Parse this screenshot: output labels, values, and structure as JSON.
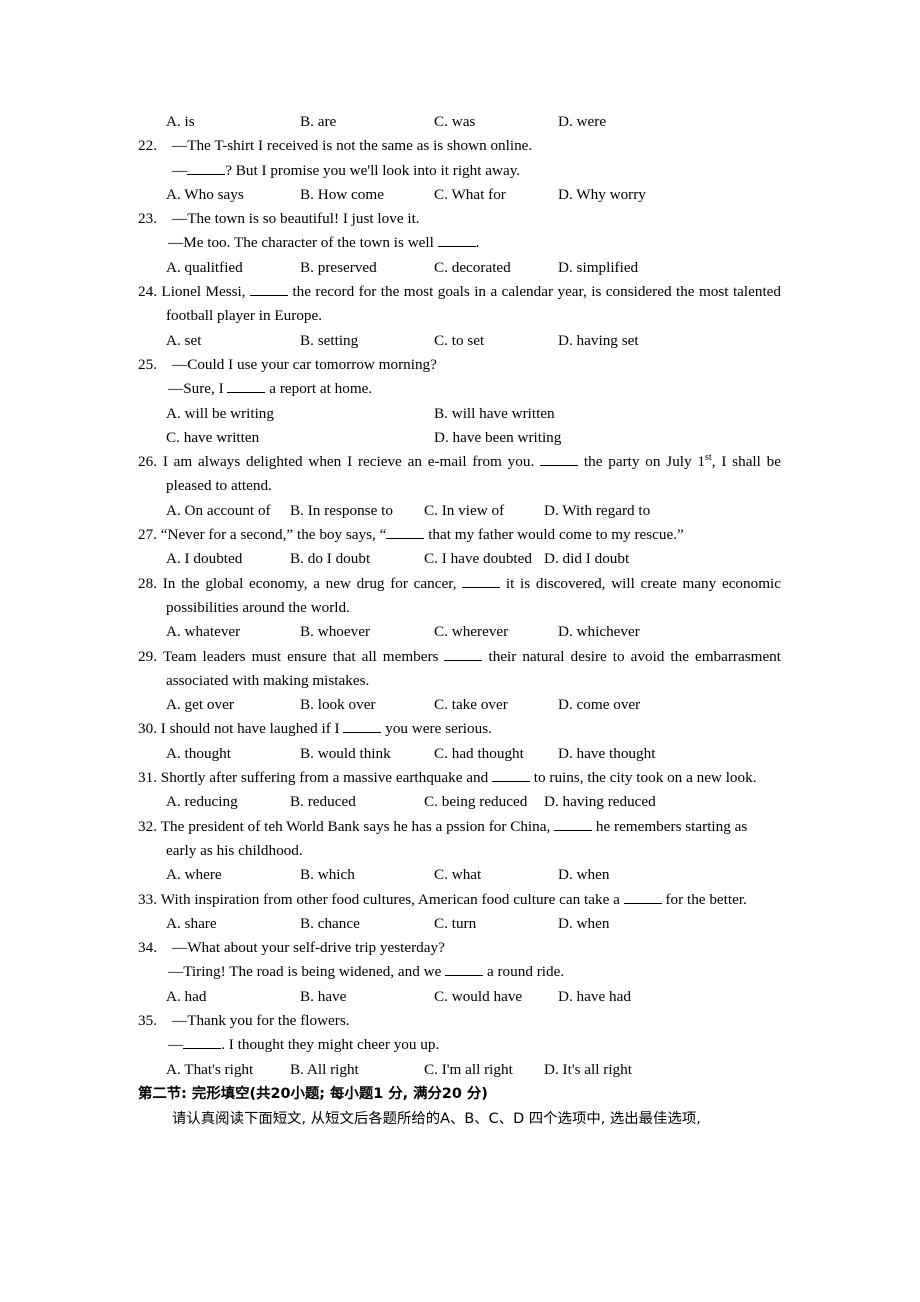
{
  "page": {
    "section_heading": "第二节: 完形填空(共20小题; 每小题1  分, 满分20  分)",
    "section_instruction": "请认真阅读下面短文, 从短文后各题所给的A、B、C、D  四个选项中, 选出最佳选项,"
  },
  "carryover_options": {
    "a": "A. is",
    "b": "B. are",
    "c": "C. was",
    "d": "D. were"
  },
  "questions": [
    {
      "number": "22.",
      "lines": [
        "—The T-shirt I received is not the same as is shown online.",
        "—_____? But I promise you we'll look into it right away."
      ],
      "options": {
        "a": "A. Who says",
        "b": "B. How come",
        "c": "C. What for",
        "d": "D. Why worry"
      }
    },
    {
      "number": "23.",
      "lines": [
        "—The town is so beautiful! I just love it.",
        "—Me too. The character of the town is well _____."
      ],
      "options": {
        "a": "A. qualitfied",
        "b": "B. preserved",
        "c": "C. decorated",
        "d": "D. simplified"
      }
    },
    {
      "number": "24.",
      "stem_pre": "Lionel Messi, ",
      "stem_post": " the record for the most goals in a calendar year, is considered the most talented football player in Europe.",
      "options": {
        "a": "A. set",
        "b": "B. setting",
        "c": "C. to set",
        "d": "D. having set"
      }
    },
    {
      "number": "25.",
      "lines": [
        "—Could I use your car tomorrow morning?",
        "—Sure, I _____ a report at home."
      ],
      "options": {
        "a": "A. will be writing",
        "b": "B. will have written",
        "c": "C. have written",
        "d": "D. have been writing"
      }
    },
    {
      "number": "26.",
      "stem_pre": "I am always delighted when I recieve an e-mail from you. ",
      "stem_mid": " the party on July 1",
      "stem_sup": "st",
      "stem_post": ", I shall be pleased to attend.",
      "options": {
        "a": "A. On account of",
        "b": "B. In response to",
        "c": "C. In view of",
        "d": "D. With regard to"
      }
    },
    {
      "number": "27.",
      "stem_pre": "“Never for a second,” the boy says, “",
      "stem_post": " that my father would come to my rescue.”",
      "options": {
        "a": "A. I doubted",
        "b": "B. do I doubt",
        "c": "C. I have doubted",
        "d": "D. did I doubt"
      }
    },
    {
      "number": "28.",
      "stem_pre": "In the global economy, a new drug for cancer, ",
      "stem_post": " it is discovered, will create many economic possibilities around the world.",
      "options": {
        "a": "A. whatever",
        "b": "B. whoever",
        "c": "C. wherever",
        "d": "D. whichever"
      }
    },
    {
      "number": "29.",
      "stem_pre": "Team leaders must ensure that all members ",
      "stem_post": " their natural desire to avoid the embarrasment associated with making mistakes.",
      "options": {
        "a": "A. get over",
        "b": "B. look over",
        "c": "C. take over",
        "d": "D. come over"
      }
    },
    {
      "number": "30.",
      "stem_pre": "I should not have laughed if I ",
      "stem_post": " you were serious.",
      "options": {
        "a": "A. thought",
        "b": "B. would think",
        "c": "C. had thought",
        "d": "D. have thought"
      }
    },
    {
      "number": "31.",
      "stem_pre": "Shortly after suffering from a massive earthquake and ",
      "stem_post": " to ruins, the city took on a new look.",
      "options": {
        "a": "A. reducing",
        "b": "B. reduced",
        "c": "C. being reduced",
        "d": "D. having reduced"
      }
    },
    {
      "number": "32.",
      "stem_pre": "The president of teh World Bank says he has a pssion for China, ",
      "stem_post": " he remembers starting as early as his childhood.",
      "options": {
        "a": "A. where",
        "b": "B. which",
        "c": "C. what",
        "d": "D. when"
      }
    },
    {
      "number": "33.",
      "stem_pre": "With inspiration from other food cultures, American food culture can take a ",
      "stem_post": " for the better.",
      "options": {
        "a": "A. share",
        "b": "B. chance",
        "c": "C. turn",
        "d": "D. when"
      }
    },
    {
      "number": "34.",
      "lines": [
        "—What about your self-drive trip yesterday?",
        "—Tiring! The road is being widened, and we _____ a round ride."
      ],
      "options": {
        "a": "A. had",
        "b": "B. have",
        "c": "C. would have",
        "d": "D. have had"
      }
    },
    {
      "number": "35.",
      "lines": [
        "—Thank you for the flowers.",
        "—_____. I thought they might cheer you up."
      ],
      "options": {
        "a": "A. That's right",
        "b": "B. All right",
        "c": "C. I'm all right",
        "d": "D. It's all right"
      }
    }
  ]
}
